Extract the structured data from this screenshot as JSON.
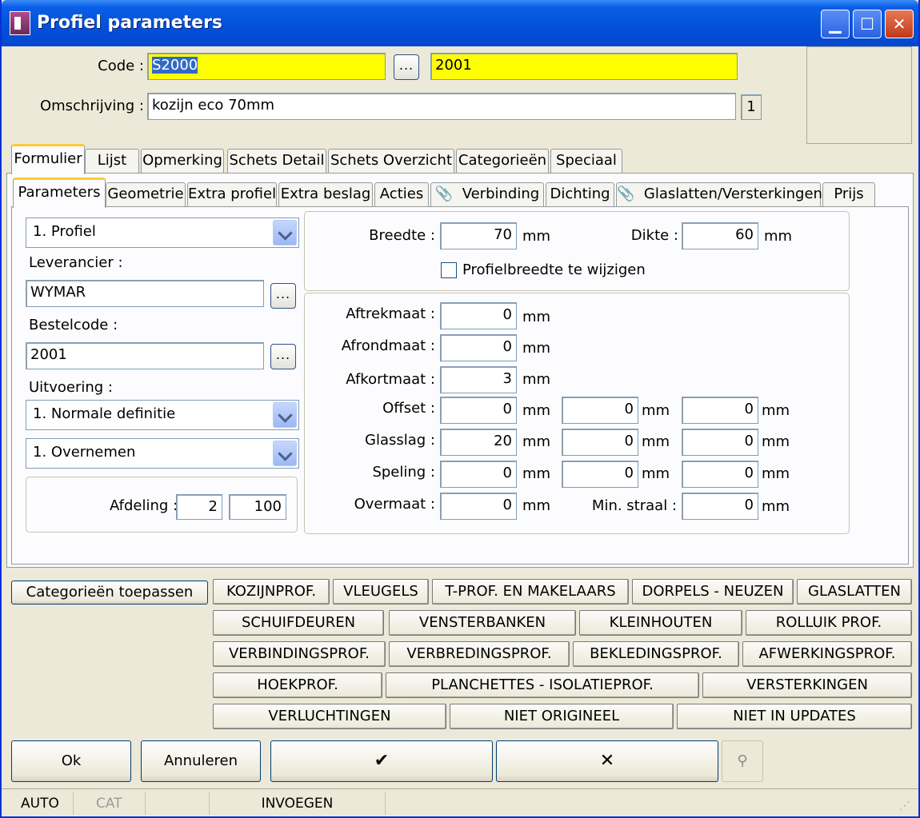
{
  "window": {
    "title": "Profiel parameters"
  },
  "header": {
    "code_label": "Code :",
    "code_value": "S2000",
    "code_right_value": "2001",
    "desc_label": "Omschrijving :",
    "desc_value": "kozijn eco 70mm",
    "desc_counter": "1"
  },
  "outer_tabs": [
    "Formulier",
    "Lijst",
    "Opmerking",
    "Schets Detail",
    "Schets Overzicht",
    "Categorieën",
    "Speciaal"
  ],
  "inner_tabs": [
    "Parameters",
    "Geometrie",
    "Extra profiel",
    "Extra beslag",
    "Acties",
    "Verbinding",
    "Dichting",
    "Glaslatten/Versterkingen",
    "Prijs"
  ],
  "left": {
    "profiel_select": "1.  Profiel",
    "leverancier_label": "Leverancier :",
    "leverancier_value": "WYMAR",
    "bestelcode_label": "Bestelcode :",
    "bestelcode_value": "2001",
    "uitvoering_label": "Uitvoering :",
    "uitvoering_select": "1.  Normale definitie",
    "overnemen_select": "1.  Overnemen",
    "afdeling_label": "Afdeling :",
    "afdeling_1": "2",
    "afdeling_2": "100"
  },
  "top_group": {
    "breedte_label": "Breedte :",
    "breedte_value": "70",
    "dikte_label": "Dikte :",
    "dikte_value": "60",
    "checkbox_label": "Profielbreedte te wijzigen",
    "unit": "mm"
  },
  "params": {
    "aftrekmaat_label": "Aftrekmaat :",
    "aftrekmaat": "0",
    "afrondmaat_label": "Afrondmaat :",
    "afrondmaat": "0",
    "afkortmaat_label": "Afkortmaat :",
    "afkortmaat": "3",
    "offset_label": "Offset :",
    "offset": [
      "0",
      "0",
      "0"
    ],
    "glasslag_label": "Glasslag :",
    "glasslag": [
      "20",
      "0",
      "0"
    ],
    "speling_label": "Speling :",
    "speling": [
      "0",
      "0",
      "0"
    ],
    "overmaat_label": "Overmaat :",
    "overmaat": "0",
    "minstraal_label": "Min. straal :",
    "minstraal": "0"
  },
  "categories": {
    "apply_label": "Categorieën toepassen",
    "row1": [
      "KOZIJNPROF.",
      "VLEUGELS",
      "T-PROF. EN MAKELAARS",
      "DORPELS - NEUZEN",
      "GLASLATTEN"
    ],
    "row2": [
      "SCHUIFDEUREN",
      "VENSTERBANKEN",
      "KLEINHOUTEN",
      "ROLLUIK PROF."
    ],
    "row3": [
      "VERBINDINGSPROF.",
      "VERBREDINGSPROF.",
      "BEKLEDINGSPROF.",
      "AFWERKINGSPROF."
    ],
    "row4": [
      "HOEKPROF.",
      "PLANCHETTES - ISOLATIEPROF.",
      "VERSTERKINGEN"
    ],
    "row5": [
      "VERLUCHTINGEN",
      "NIET ORIGINEEL",
      "NIET IN UPDATES"
    ]
  },
  "actions": {
    "ok": "Ok",
    "cancel": "Annuleren",
    "check": "✔",
    "cross": "✕"
  },
  "status": {
    "auto": "AUTO",
    "cat": "CAT",
    "mode": "INVOEGEN"
  }
}
